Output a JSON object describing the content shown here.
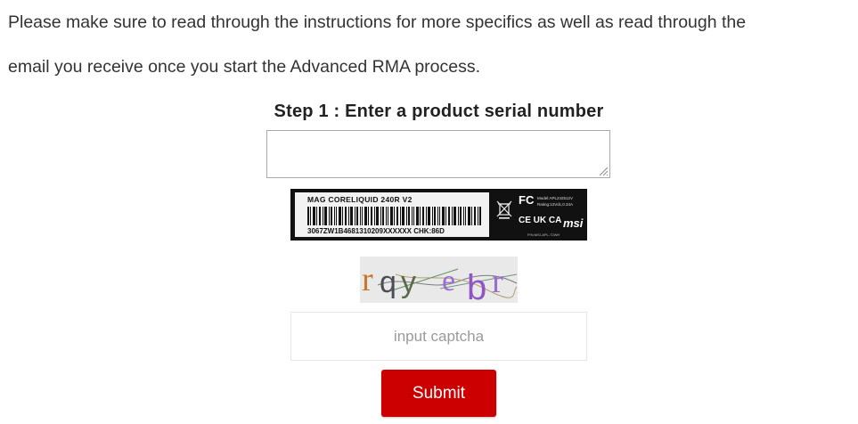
{
  "intro": {
    "line1": "Please make sure to read through the instructions for more specifics as well as read through the",
    "line2": "email you receive once you start the Advanced RMA process."
  },
  "step1": {
    "title": "Step 1 : Enter a product serial number",
    "serial_value": ""
  },
  "product_label": {
    "model": "MAG CORELIQUID 240R V2",
    "serial": "3067ZW1B4681310209XXXXXX  CHK:86D",
    "fc": "FC",
    "spec_model": "Model:APL242512V",
    "spec_rating": "Rating:12Vdc,0.34A",
    "certs": "CE UK CA",
    "brand": "msi",
    "code": "P/N:MSI-APL-72WH"
  },
  "captcha": {
    "text": "rqyebr",
    "input_placeholder": "input captcha",
    "input_value": ""
  },
  "submit": {
    "label": "Submit"
  },
  "colors": {
    "button": "#cc0000",
    "text": "#333333"
  }
}
